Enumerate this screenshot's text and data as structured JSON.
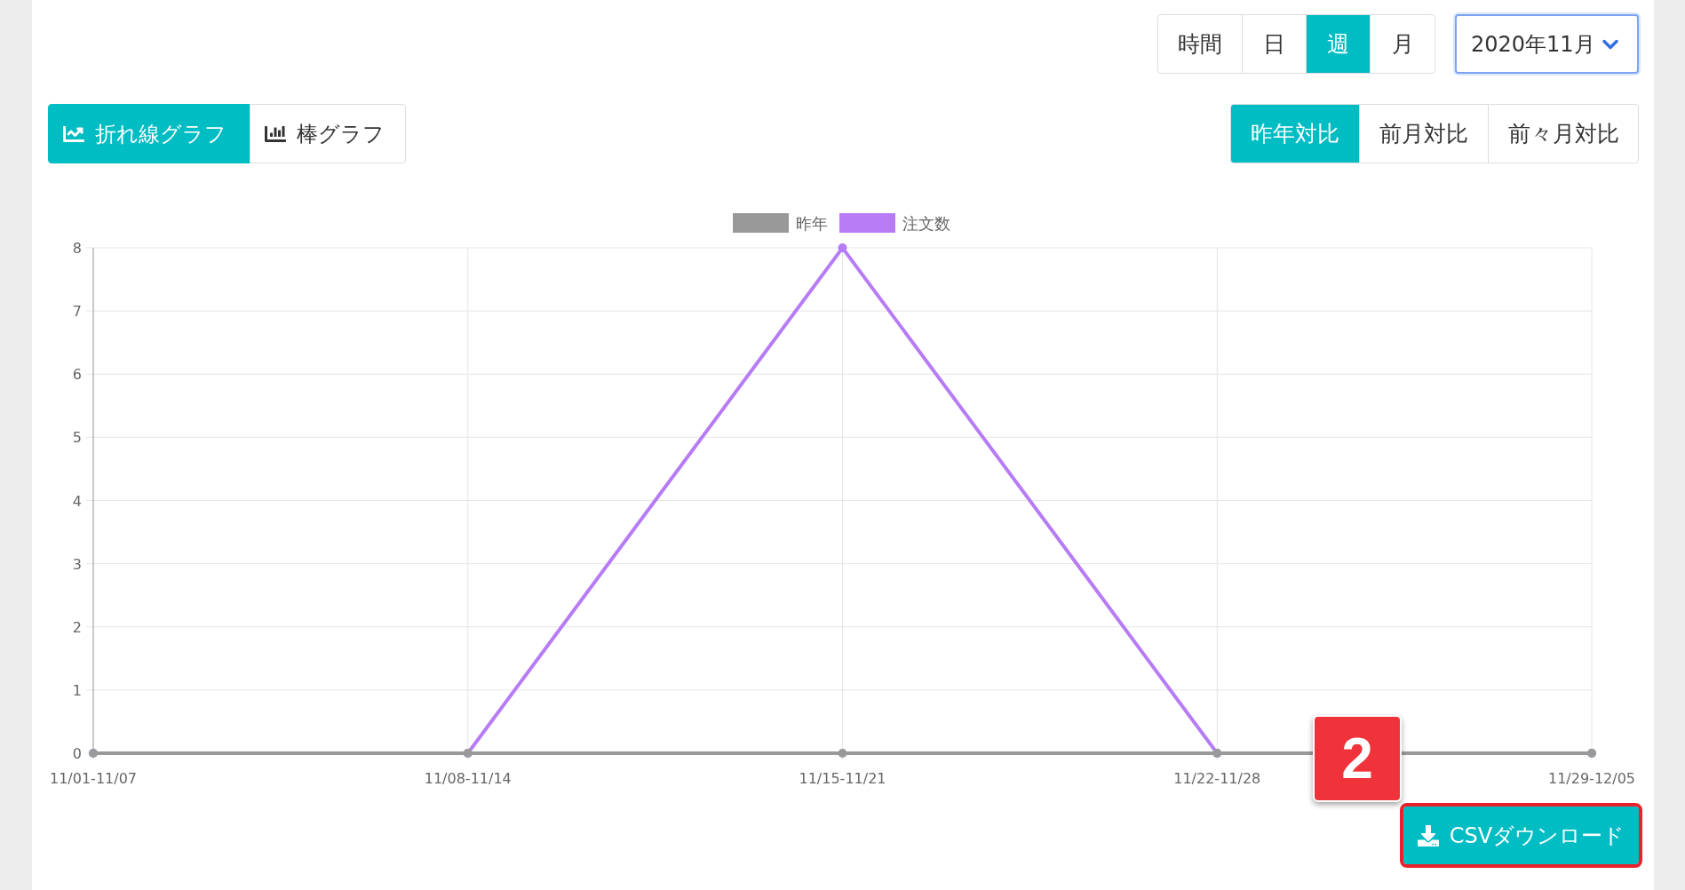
{
  "period_tabs": [
    {
      "label": "時間",
      "selected": false
    },
    {
      "label": "日",
      "selected": false
    },
    {
      "label": "週",
      "selected": true
    },
    {
      "label": "月",
      "selected": false
    }
  ],
  "month_select": {
    "value": "2020年11月"
  },
  "chart_type_tabs": [
    {
      "label": "折れ線グラフ",
      "kind": "line",
      "selected": true
    },
    {
      "label": "棒グラフ",
      "kind": "bar",
      "selected": false
    }
  ],
  "compare_tabs": [
    {
      "label": "昨年対比",
      "selected": true
    },
    {
      "label": "前月対比",
      "selected": false
    },
    {
      "label": "前々月対比",
      "selected": false
    }
  ],
  "chart": {
    "chart_data": {
      "type": "line",
      "grid": true,
      "legend": true,
      "categories": [
        "11/01-11/07",
        "11/08-11/14",
        "11/15-11/21",
        "11/22-11/28",
        "11/29-12/05"
      ],
      "ylim": [
        0,
        8
      ],
      "yticks": [
        0,
        1,
        2,
        3,
        4,
        5,
        6,
        7,
        8
      ],
      "series": [
        {
          "name": "昨年",
          "color": "#999999",
          "marker": "circle",
          "values": [
            0,
            0,
            0,
            0,
            0
          ]
        },
        {
          "name": "注文数",
          "color": "#b77cf5",
          "marker": "circle",
          "values": [
            0,
            0,
            8,
            0,
            0
          ]
        }
      ]
    }
  },
  "annotation_badge": "2",
  "csv_button": {
    "label": "CSVダウンロード"
  }
}
